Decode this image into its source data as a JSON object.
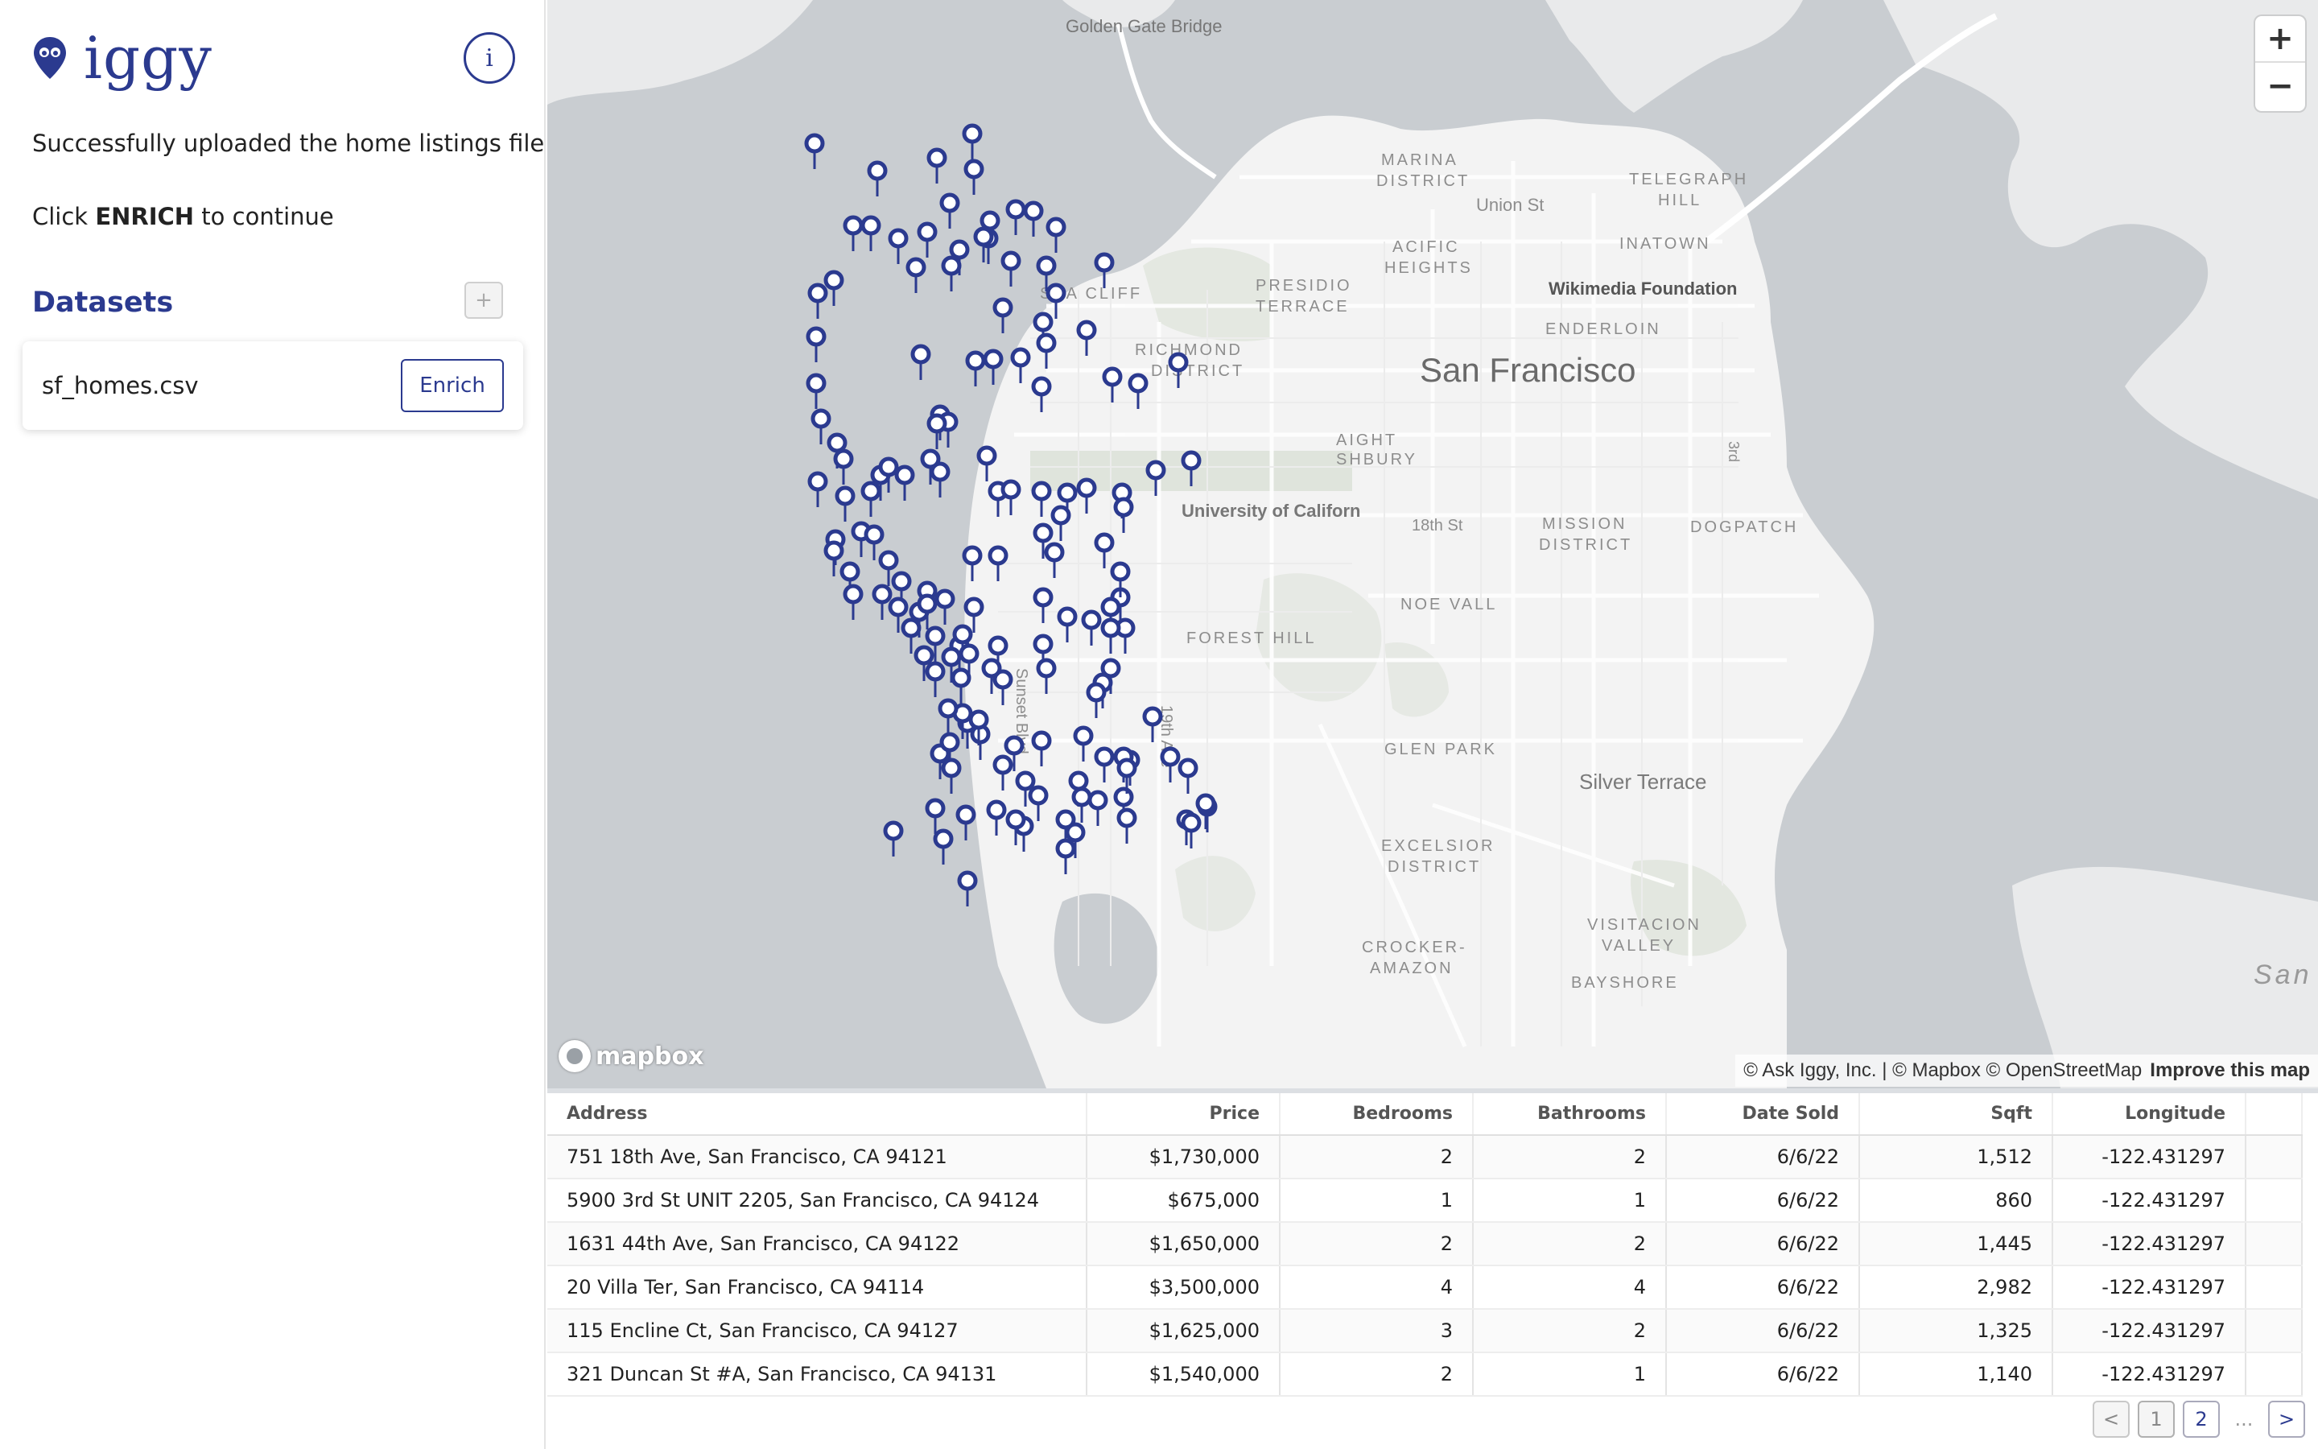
{
  "app": {
    "logo_text": "iggy",
    "info_label": "i"
  },
  "messages": {
    "uploaded": "Successfully uploaded the home listings file!",
    "click_prefix": "Click ",
    "click_action": "ENRICH",
    "click_suffix": " to continue"
  },
  "datasets": {
    "title": "Datasets",
    "add_label": "+",
    "items": [
      {
        "name": "sf_homes.csv",
        "action_label": "Enrich"
      }
    ]
  },
  "map": {
    "zoom_in": "+",
    "zoom_out": "−",
    "mapbox_logo": "mapbox",
    "attribution": "© Ask Iggy, Inc. | © Mapbox © OpenStreetMap",
    "attribution_link": "Improve this map",
    "marker_color": "#2b3a8f",
    "labels": {
      "golden_gate": "Golden Gate Bridge",
      "marina": "MARINA",
      "district": "DISTRICT",
      "telegraph": "TELEGRAPH",
      "hill": "HILL",
      "union_st": "Union St",
      "chinatown": "INATOWN",
      "pacific": "ACIFIC",
      "heights": "HEIGHTS",
      "presidio": "PRESIDIO",
      "terrace": "TERRACE",
      "wikimedia": "Wikimedia Foundation",
      "sea_cliff": "SEA CLIFF",
      "richmond": "RICHMOND",
      "richmond_district": "DISTRICT",
      "san_francisco": "San Francisco",
      "tenderloin": "ENDERLOIN",
      "haight": "AIGHT",
      "ashbury": "SHBURY",
      "ucsf": "University of Californ",
      "st_18th": "18th St",
      "mission": "MISSION",
      "mission_district": "DISTRICT",
      "dogpatch": "DOGPATCH",
      "noe": "NOE VALL",
      "forest_hill": "FOREST HILL",
      "sunset": "Sunset Blvd",
      "ave_19th": "19th Ave",
      "glen_park": "GLEN PARK",
      "silver_terrace": "Silver Terrace",
      "excelsior": "EXCELSIOR",
      "excelsior_district": "DISTRICT",
      "visitacion": "VISITACION",
      "valley": "VALLEY",
      "crocker": "CROCKER-",
      "amazon": "AMAZON",
      "bayshore": "BAYSHORE",
      "san_right": "San",
      "st_3rd": "3rd"
    }
  },
  "table": {
    "columns": [
      "Address",
      "Price",
      "Bedrooms",
      "Bathrooms",
      "Date Sold",
      "Sqft",
      "Longitude"
    ],
    "rows": [
      [
        "751 18th Ave, San Francisco, CA 94121",
        "$1,730,000",
        "2",
        "2",
        "6/6/22",
        "1,512",
        "-122.431297"
      ],
      [
        "5900 3rd St UNIT 2205, San Francisco, CA 94124",
        "$675,000",
        "1",
        "1",
        "6/6/22",
        "860",
        "-122.431297"
      ],
      [
        "1631 44th Ave, San Francisco, CA 94122",
        "$1,650,000",
        "2",
        "2",
        "6/6/22",
        "1,445",
        "-122.431297"
      ],
      [
        "20 Villa Ter, San Francisco, CA 94114",
        "$3,500,000",
        "4",
        "4",
        "6/6/22",
        "2,982",
        "-122.431297"
      ],
      [
        "115 Encline Ct, San Francisco, CA 94127",
        "$1,625,000",
        "3",
        "2",
        "6/6/22",
        "1,325",
        "-122.431297"
      ],
      [
        "321 Duncan St #A, San Francisco, CA 94131",
        "$1,540,000",
        "2",
        "1",
        "6/6/22",
        "1,140",
        "-122.431297"
      ]
    ]
  },
  "pagination": {
    "prev": "<",
    "pages": [
      "1",
      "2"
    ],
    "ellipsis": "...",
    "next": ">"
  }
}
